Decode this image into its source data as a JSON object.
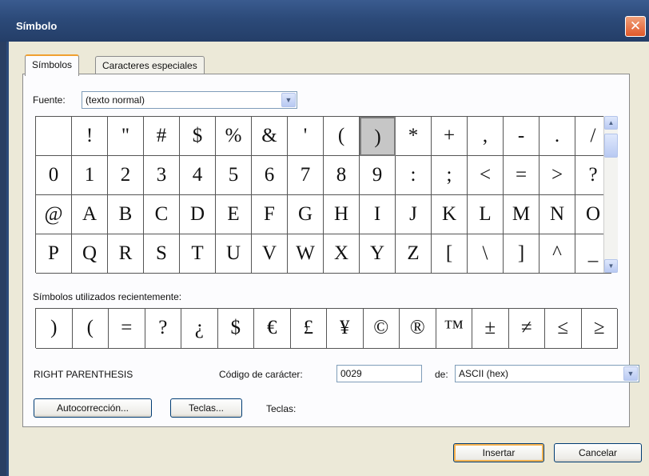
{
  "dialog": {
    "title": "Símbolo",
    "close_label": "✕"
  },
  "tabs": [
    {
      "label": "Símbolos",
      "active": true
    },
    {
      "label": "Caracteres especiales",
      "active": false
    }
  ],
  "font": {
    "label": "Fuente:",
    "value": "(texto normal)"
  },
  "symbol_grid": {
    "rows": [
      [
        " ",
        "!",
        "\"",
        "#",
        "$",
        "%",
        "&",
        "'",
        "(",
        ")",
        "*",
        "+",
        ",",
        "-",
        ".",
        "/"
      ],
      [
        "0",
        "1",
        "2",
        "3",
        "4",
        "5",
        "6",
        "7",
        "8",
        "9",
        ":",
        ";",
        "<",
        "=",
        ">",
        "?"
      ],
      [
        "@",
        "A",
        "B",
        "C",
        "D",
        "E",
        "F",
        "G",
        "H",
        "I",
        "J",
        "K",
        "L",
        "M",
        "N",
        "O"
      ],
      [
        "P",
        "Q",
        "R",
        "S",
        "T",
        "U",
        "V",
        "W",
        "X",
        "Y",
        "Z",
        "[",
        "\\",
        "]",
        "^",
        "_"
      ]
    ],
    "selected": ")"
  },
  "recent": {
    "label": "Símbolos utilizados recientemente:",
    "symbols": [
      ")",
      "(",
      "=",
      "?",
      "¿",
      "$",
      "€",
      "£",
      "¥",
      "©",
      "®",
      "™",
      "±",
      "≠",
      "≤",
      "≥"
    ]
  },
  "char_name": "RIGHT PARENTHESIS",
  "char_code": {
    "label": "Código de carácter:",
    "value": "0029"
  },
  "from": {
    "label": "de:",
    "value": "ASCII (hex)"
  },
  "buttons": {
    "autocorrect": "Autocorrección...",
    "keys": "Teclas...",
    "keys_label": "Teclas:",
    "insert": "Insertar",
    "cancel": "Cancelar"
  }
}
